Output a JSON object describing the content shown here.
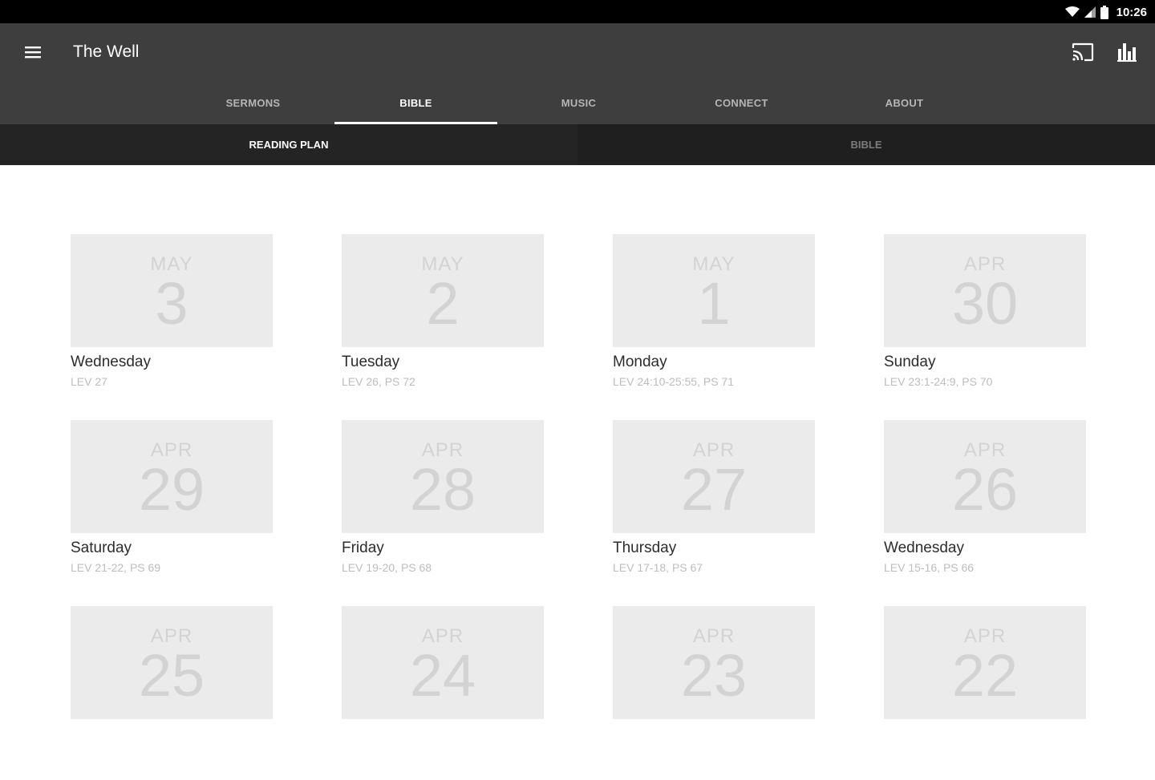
{
  "status_bar": {
    "time": "10:26"
  },
  "app_bar": {
    "title": "The Well"
  },
  "tabs": [
    {
      "label": "SERMONS",
      "active": false
    },
    {
      "label": "BIBLE",
      "active": true
    },
    {
      "label": "MUSIC",
      "active": false
    },
    {
      "label": "CONNECT",
      "active": false
    },
    {
      "label": "ABOUT",
      "active": false
    }
  ],
  "subtabs": [
    {
      "label": "READING PLAN",
      "active": true
    },
    {
      "label": "BIBLE",
      "active": false
    }
  ],
  "readings": [
    {
      "month": "MAY",
      "day": "3",
      "weekday": "Wednesday",
      "passage": "LEV 27"
    },
    {
      "month": "MAY",
      "day": "2",
      "weekday": "Tuesday",
      "passage": "LEV 26, PS 72"
    },
    {
      "month": "MAY",
      "day": "1",
      "weekday": "Monday",
      "passage": "LEV 24:10-25:55, PS 71"
    },
    {
      "month": "APR",
      "day": "30",
      "weekday": "Sunday",
      "passage": "LEV 23:1-24:9, PS 70"
    },
    {
      "month": "APR",
      "day": "29",
      "weekday": "Saturday",
      "passage": "LEV 21-22, PS 69"
    },
    {
      "month": "APR",
      "day": "28",
      "weekday": "Friday",
      "passage": "LEV 19-20, PS 68"
    },
    {
      "month": "APR",
      "day": "27",
      "weekday": "Thursday",
      "passage": "LEV 17-18, PS 67"
    },
    {
      "month": "APR",
      "day": "26",
      "weekday": "Wednesday",
      "passage": "LEV 15-16, PS 66"
    },
    {
      "month": "APR",
      "day": "25",
      "weekday": "",
      "passage": ""
    },
    {
      "month": "APR",
      "day": "24",
      "weekday": "",
      "passage": ""
    },
    {
      "month": "APR",
      "day": "23",
      "weekday": "",
      "passage": ""
    },
    {
      "month": "APR",
      "day": "22",
      "weekday": "",
      "passage": ""
    }
  ],
  "icons": {
    "menu": "hamburger-menu-icon",
    "cast": "cast-icon",
    "stats": "bar-chart-icon",
    "wifi": "wifi-icon",
    "signal": "signal-icon",
    "battery": "battery-icon"
  },
  "colors": {
    "app_bar": "#3e3e3e",
    "subtab_bar": "#1f1f1f",
    "status_bar": "#000000",
    "card_bg": "#ebebeb"
  }
}
